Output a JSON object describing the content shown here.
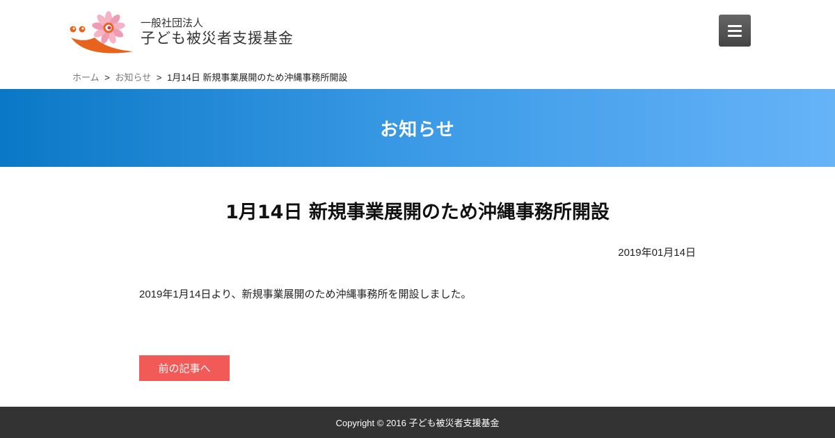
{
  "header": {
    "org_type": "一般社団法人",
    "org_name": "子ども被災者支援基金",
    "logo_colors": {
      "orange": "#e8641c",
      "pink": "#f0a0b8",
      "red": "#d9314a"
    },
    "menu_icon": "hamburger-icon"
  },
  "breadcrumb": {
    "home": "ホーム",
    "section": "お知らせ",
    "current": "1月14日 新規事業展開のため沖縄事務所開設",
    "separator": ">"
  },
  "banner": {
    "title": "お知らせ",
    "gradient": [
      "#0a78c6",
      "#66b3f8"
    ]
  },
  "article": {
    "title": "1月14日 新規事業展開のため沖縄事務所開設",
    "date": "2019年01月14日",
    "body": "2019年1月14日より、新規事業展開のため沖縄事務所を開設しました。"
  },
  "nav": {
    "prev_label": "前の記事へ",
    "prev_color": "#f25a58"
  },
  "footer": {
    "copyright": "Copyright © 2016 子ども被災者支援基金"
  }
}
